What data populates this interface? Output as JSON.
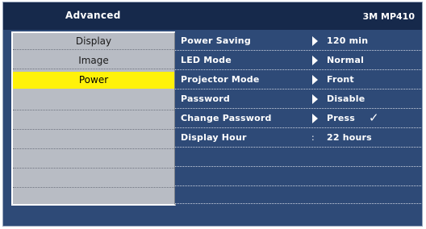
{
  "header": {
    "title": "Advanced",
    "model": "3M MP410"
  },
  "menu": {
    "items": [
      {
        "label": "Display",
        "selected": false
      },
      {
        "label": "Image",
        "selected": false
      },
      {
        "label": "Power",
        "selected": true
      }
    ]
  },
  "settings": [
    {
      "label": "Power Saving",
      "separator": "arrow",
      "value": "120 min"
    },
    {
      "label": "LED Mode",
      "separator": "arrow",
      "value": "Normal"
    },
    {
      "label": "Projector Mode",
      "separator": "arrow",
      "value": "Front"
    },
    {
      "label": "Password",
      "separator": "arrow",
      "value": "Disable"
    },
    {
      "label": "Change Password",
      "separator": "arrow",
      "value": "Press",
      "mark": "✓"
    },
    {
      "label": "Display Hour",
      "separator": ":",
      "value": "22 hours"
    }
  ],
  "colors": {
    "background": "#2e4a77",
    "title_bar": "#16294b",
    "menu_panel": "#b8bcc4",
    "selected_highlight": "#fff20a"
  },
  "icons": {
    "row_arrow": "triangle-right-icon",
    "confirm": "checkmark-icon"
  }
}
